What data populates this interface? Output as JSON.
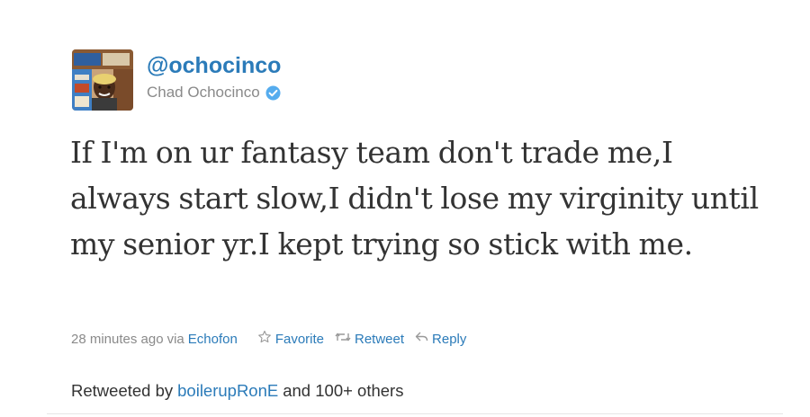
{
  "tweet": {
    "handle": "@ochocinco",
    "display_name": "Chad Ochocinco",
    "verified": true,
    "text": "If I'm on ur fantasy team don't trade me,I always start slow,I didn't lose my virginity until my senior yr.I kept trying so stick with me.",
    "timestamp": "28 minutes ago",
    "via_label": "via",
    "source": "Echofon"
  },
  "actions": {
    "favorite_label": "Favorite",
    "retweet_label": "Retweet",
    "reply_label": "Reply"
  },
  "retweeted": {
    "prefix": "Retweeted by",
    "user": "boilerupRonE",
    "suffix": "and 100+ others"
  },
  "icons": {
    "verified": "verified-badge-icon",
    "favorite": "star-outline-icon",
    "retweet": "retweet-arrows-icon",
    "reply": "reply-arrow-icon"
  },
  "colors": {
    "link": "#2b7bb9",
    "muted": "#8a8a8a",
    "text": "#333333",
    "verified": "#55acee"
  }
}
